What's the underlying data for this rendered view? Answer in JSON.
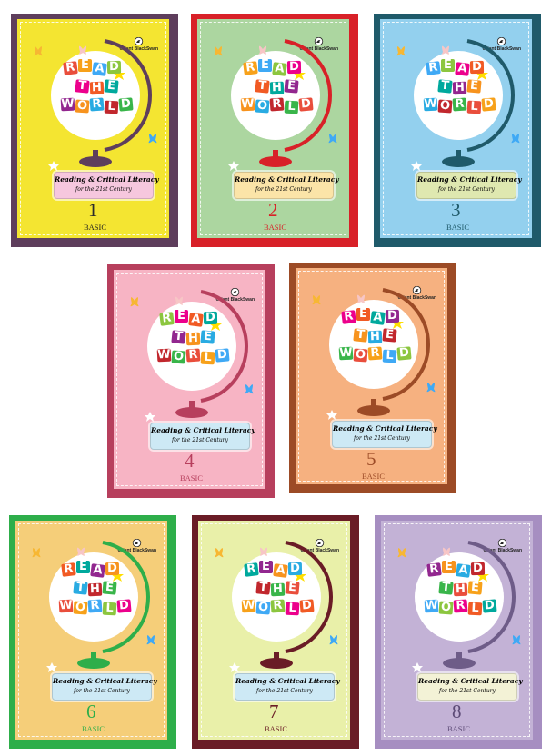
{
  "series_title": [
    "READ",
    "THE",
    "WORLD"
  ],
  "subtitle_line1": "Reading & Critical Literacy",
  "subtitle_line2": "for the 21st Century",
  "publisher": "Orient BlackSwan",
  "level_label": "BASIC",
  "covers": [
    {
      "number": "1",
      "frame": "#5e3e5c",
      "fill": "#f4e531",
      "stand": "#5e3e5c",
      "box": "#f6c7de",
      "digit": "#2b2b2b",
      "level": "#1f1f1f"
    },
    {
      "number": "2",
      "frame": "#d82128",
      "fill": "#acd6a0",
      "stand": "#d82128",
      "box": "#fbe4a8",
      "digit": "#d82128",
      "level": "#d82128"
    },
    {
      "number": "3",
      "frame": "#1f5a6a",
      "fill": "#93d0ee",
      "stand": "#1f5a6a",
      "box": "#dfe8b0",
      "digit": "#1f5a6a",
      "level": "#1f5a6a"
    },
    {
      "number": "4",
      "frame": "#b73f5d",
      "fill": "#f7b4c4",
      "stand": "#b73f5d",
      "box": "#cde9f5",
      "digit": "#b73f5d",
      "level": "#b73f5d"
    },
    {
      "number": "5",
      "frame": "#9c4b26",
      "fill": "#f6b180",
      "stand": "#9c4b26",
      "box": "#cde9f5",
      "digit": "#9c4b26",
      "level": "#9c4b26"
    },
    {
      "number": "6",
      "frame": "#2eae4a",
      "fill": "#f5ce79",
      "stand": "#2eae4a",
      "box": "#cde9f5",
      "digit": "#2eae4a",
      "level": "#2eae4a"
    },
    {
      "number": "7",
      "frame": "#6a1c26",
      "fill": "#e9f0a9",
      "stand": "#6a1c26",
      "box": "#cde9f5",
      "digit": "#6a1c26",
      "level": "#6a1c26"
    },
    {
      "number": "8",
      "frame": "#a68ec1",
      "fill": "#c3b2d6",
      "stand": "#6e5c88",
      "box": "#f3f2d6",
      "digit": "#5c4a76",
      "level": "#5c4a76"
    }
  ],
  "tile_colors": [
    "#e94e3c",
    "#f7a11a",
    "#3fa9f5",
    "#8cc63f",
    "#ec008c",
    "#f15a24",
    "#00a99d",
    "#92278f",
    "#f7931e",
    "#29abe2",
    "#c1272d",
    "#39b54a"
  ]
}
